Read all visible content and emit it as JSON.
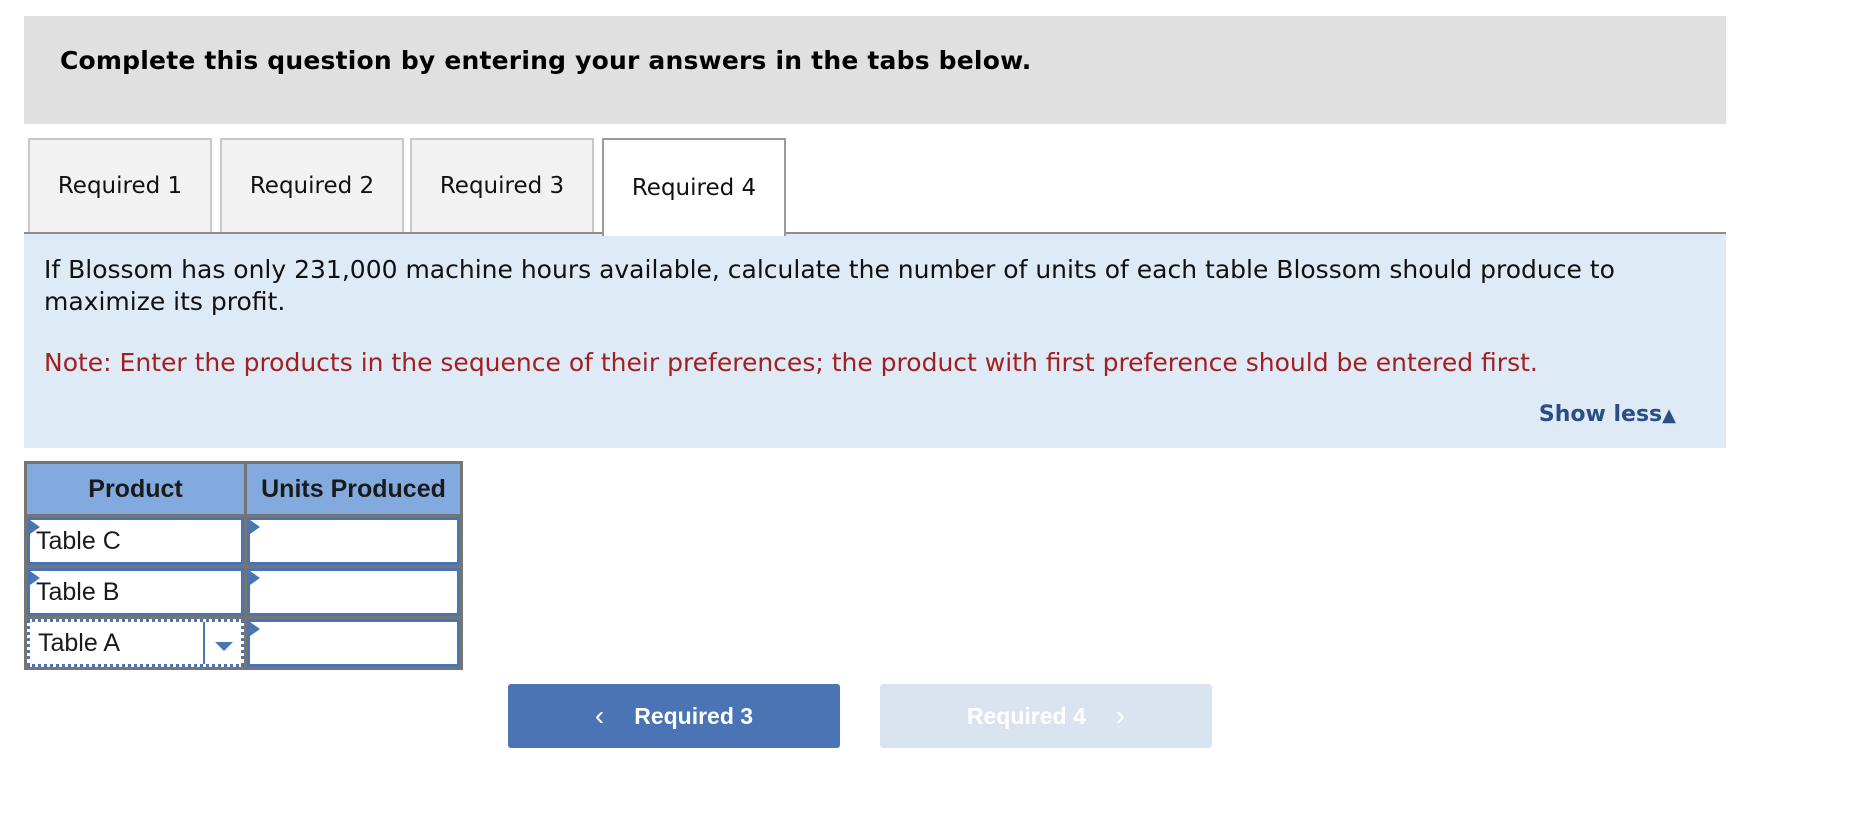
{
  "header": {
    "title": "Complete this question by entering your answers in the tabs below."
  },
  "tabs": [
    {
      "label": "Required 1",
      "active": false
    },
    {
      "label": "Required 2",
      "active": false
    },
    {
      "label": "Required 3",
      "active": false
    },
    {
      "label": "Required 4",
      "active": true
    }
  ],
  "panel": {
    "question": "If Blossom has only 231,000 machine hours available, calculate the number of units of each table Blossom should produce to maximize its profit.",
    "note": "Note: Enter the products in the sequence of their preferences; the product with first preference should be entered first.",
    "show_less": "Show less",
    "show_less_icon": "▲"
  },
  "table": {
    "headers": [
      "Product",
      "Units Produced"
    ],
    "rows": [
      {
        "product": "Table C",
        "units": ""
      },
      {
        "product": "Table B",
        "units": ""
      },
      {
        "product": "Table A",
        "units": ""
      }
    ]
  },
  "nav": {
    "prev_label": "Required 3",
    "prev_icon": "‹",
    "next_label": "Required 4",
    "next_icon": "›"
  },
  "colors": {
    "accent": "#4a74b4",
    "header_bg": "#e0e0e0",
    "panel_bg": "#deebf7",
    "note_red": "#a31f1f",
    "table_header": "#83aadf",
    "disabled_btn": "#dae4f0"
  }
}
